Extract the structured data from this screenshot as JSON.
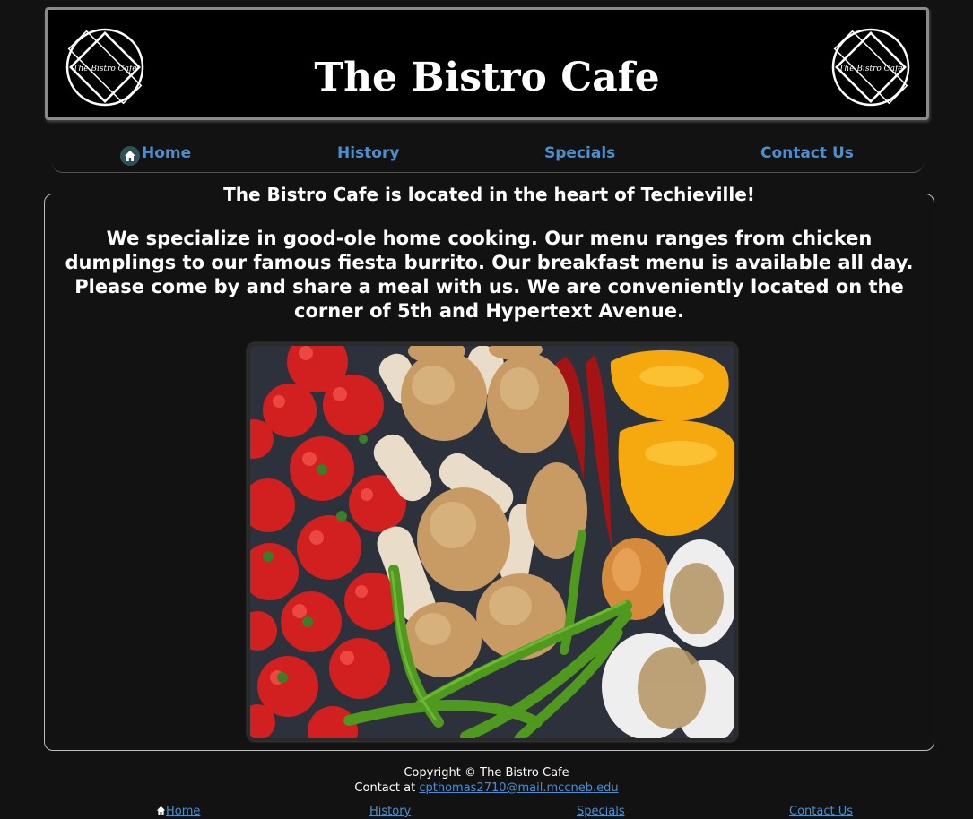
{
  "header": {
    "title": "The Bistro Cafe",
    "logo_text": "The Bistro Cafe"
  },
  "nav": {
    "items": [
      {
        "label": "Home",
        "icon": "home-icon"
      },
      {
        "label": "History"
      },
      {
        "label": "Specials"
      },
      {
        "label": "Contact Us"
      }
    ]
  },
  "main": {
    "legend": "The Bistro Cafe is located in the heart of Techieville!",
    "intro": "We specialize in good-ole home cooking. Our menu ranges from chicken dumplings to our famous fiesta burrito. Our breakfast menu is available all day. Please come by and share a meal with us. We are conveniently located on the corner of 5th and Hypertext Avenue."
  },
  "footer": {
    "copyright": "Copyright © The Bistro Cafe",
    "contact_prefix": "Contact at",
    "email": "cpthomas2710@mail.mccneb.edu"
  },
  "footer_nav": {
    "items": [
      {
        "label": "Home",
        "icon": "home-icon"
      },
      {
        "label": "History"
      },
      {
        "label": "Specials"
      },
      {
        "label": "Contact Us"
      }
    ]
  },
  "colors": {
    "background": "#121212",
    "link": "#4b8fcf",
    "header_border": "#8a8a8a"
  }
}
